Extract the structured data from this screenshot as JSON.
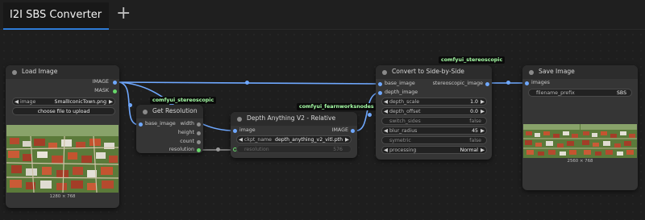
{
  "tab": {
    "title": "I2I SBS Converter",
    "add_label": "+"
  },
  "nodes": {
    "load_image": {
      "title": "Load Image",
      "outputs": [
        "IMAGE",
        "MASK"
      ],
      "image_widget": {
        "label": "image",
        "value": "SmallIconicTown.png"
      },
      "upload_label": "choose file to upload",
      "image_size": "1280 × 768"
    },
    "get_resolution": {
      "badge": "comfyui_stereoscopic",
      "title": "Get Resolution",
      "inputs": [
        "base_image"
      ],
      "outputs": [
        "width",
        "height",
        "count",
        "resolution"
      ]
    },
    "depth_anything": {
      "badge": "comfyui_fearnworksnodes",
      "title": "Depth Anything V2 - Relative",
      "inputs": [
        "image"
      ],
      "outputs": [
        "IMAGE"
      ],
      "ckpt": {
        "label": "ckpt_name",
        "value": "depth_anything_v2_vitl.pth"
      },
      "resolution": {
        "label": "resolution",
        "value": "576"
      }
    },
    "convert_sbs": {
      "badge": "comfyui_stereoscopic",
      "title": "Convert to Side-by-Side",
      "inputs": [
        "base_image",
        "depth_image"
      ],
      "outputs": [
        "stereoscopic_image"
      ],
      "widgets": [
        {
          "label": "depth_scale",
          "value": "1.0",
          "type": "number"
        },
        {
          "label": "depth_offset",
          "value": "0.0",
          "type": "number"
        },
        {
          "label": "switch_sides",
          "value": "false",
          "type": "toggle"
        },
        {
          "label": "blur_radius",
          "value": "45",
          "type": "number"
        },
        {
          "label": "symetric",
          "value": "false",
          "type": "toggle"
        },
        {
          "label": "processing",
          "value": "Normal",
          "type": "combo"
        }
      ]
    },
    "save_image": {
      "title": "Save Image",
      "inputs": [
        "images"
      ],
      "filename_prefix": {
        "label": "filename_prefix",
        "value": "SBS"
      },
      "image_size": "2560 × 768"
    }
  },
  "colors": {
    "image_link": "#6fa8ff",
    "int_link": "#8d8d8d",
    "mask": "#67d86a",
    "badge_text": "#a6ffa6",
    "tab_accent": "#2e7bd6"
  }
}
